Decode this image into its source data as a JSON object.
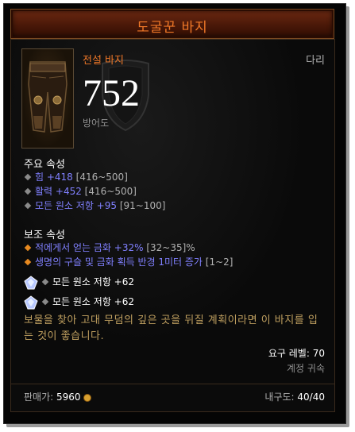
{
  "item": {
    "name": "도굴꾼 바지",
    "rarity_type": "전설 바지",
    "slot": "다리",
    "armor_value": "752",
    "armor_label": "방어도"
  },
  "primary": {
    "title": "주요 속성",
    "stats": [
      {
        "text": "힘 +418",
        "range": " [416~500]"
      },
      {
        "text": "활력 +452",
        "range": " [416~500]"
      },
      {
        "text": "모든 원소 저항 +95",
        "range": " [91~100]"
      }
    ]
  },
  "secondary": {
    "title": "보조 속성",
    "stats": [
      {
        "text": "적에게서 얻는 금화 +32%",
        "range": " [32~35]%"
      },
      {
        "text": "생명의 구슬 및 금화 획득 반경 1미터 증가",
        "range": " [1~2]"
      }
    ]
  },
  "sockets": [
    {
      "text": "모든 원소 저항 +62",
      "icon": "gem-icon"
    },
    {
      "text": "모든 원소 저항 +62",
      "icon": "gem-icon"
    }
  ],
  "flavor": "보물을 찾아 고대 무덤의 깊은 곳을 뒤질 계획이라면 이 바지를 입는 것이 좋습니다.",
  "requirement": {
    "label": "요구 레벨:",
    "value": "70"
  },
  "account_bound": "계정 귀속",
  "price": {
    "label": "판매가:",
    "value": "5960"
  },
  "durability": {
    "label": "내구도:",
    "value": "40/40"
  },
  "colors": {
    "legendary": "#f07828",
    "magic": "#8080ff",
    "flavor": "#c0a060"
  }
}
